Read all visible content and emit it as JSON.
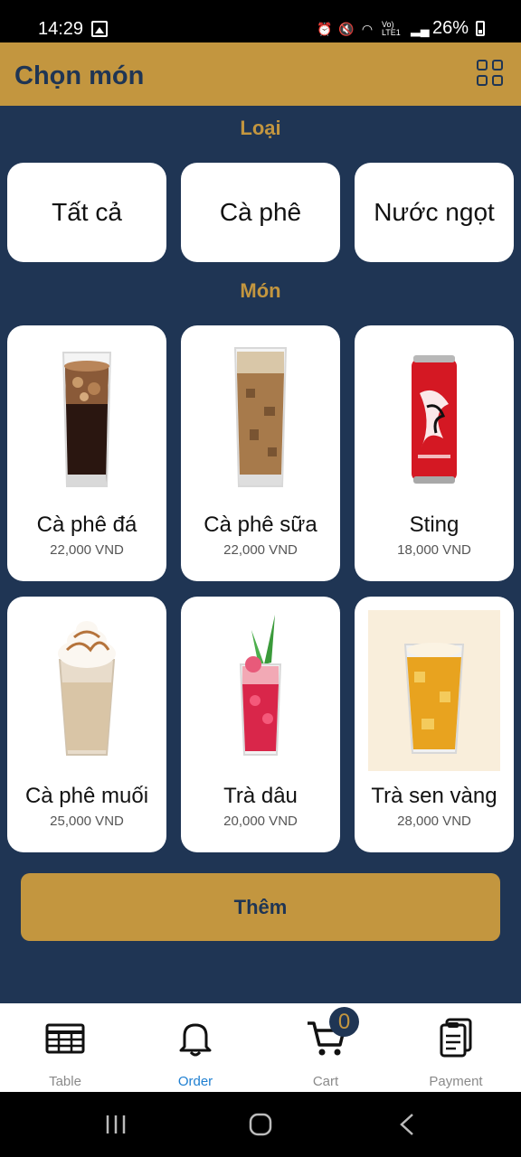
{
  "status_bar": {
    "time": "14:29",
    "battery": "26%",
    "network": "Vo) LTE1"
  },
  "header": {
    "title": "Chọn món"
  },
  "categories": {
    "label": "Loại",
    "items": [
      "Tất cả",
      "Cà phê",
      "Nước ngọt"
    ]
  },
  "menu": {
    "label": "Món",
    "items": [
      {
        "name": "Cà phê đá",
        "price": "22,000 VND"
      },
      {
        "name": "Cà phê sữa",
        "price": "22,000 VND"
      },
      {
        "name": "Sting",
        "price": "18,000 VND"
      },
      {
        "name": "Cà phê muối",
        "price": "25,000 VND"
      },
      {
        "name": "Trà dâu",
        "price": "20,000 VND"
      },
      {
        "name": "Trà sen vàng",
        "price": "28,000 VND"
      }
    ]
  },
  "add_button": "Thêm",
  "bottom_nav": {
    "items": [
      "Table",
      "Order",
      "Cart",
      "Payment"
    ],
    "cart_count": "0"
  },
  "colors": {
    "navy": "#1f3554",
    "gold": "#c3963f",
    "active": "#1e7fd1"
  }
}
